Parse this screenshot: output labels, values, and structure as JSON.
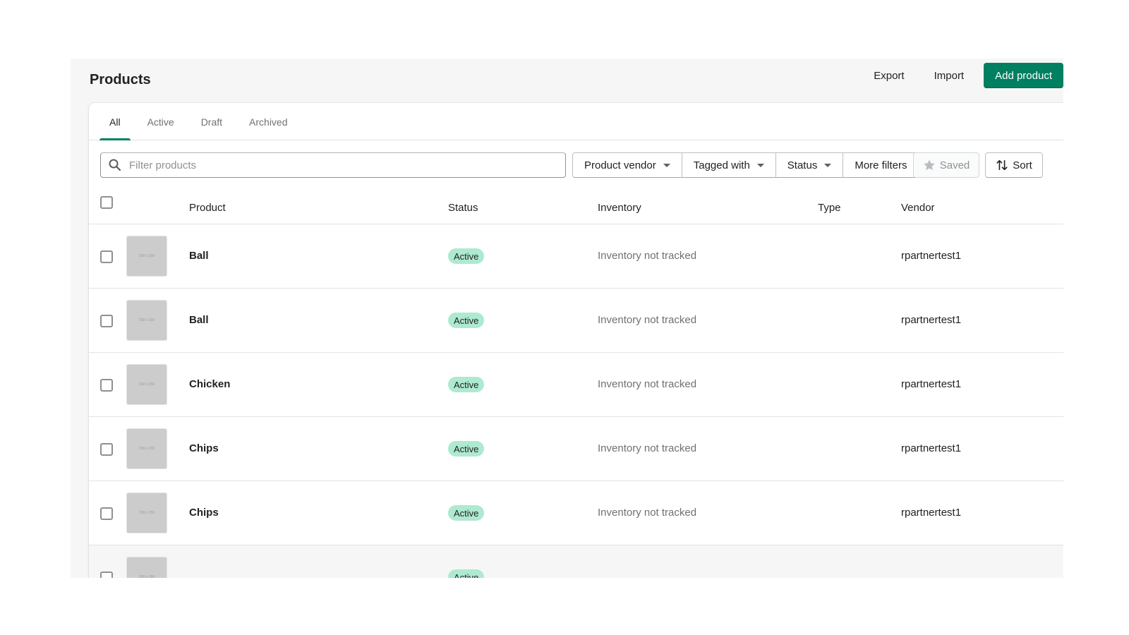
{
  "header": {
    "title": "Products",
    "export_label": "Export",
    "import_label": "Import",
    "add_label": "Add product"
  },
  "tabs": [
    {
      "label": "All",
      "active": true
    },
    {
      "label": "Active"
    },
    {
      "label": "Draft"
    },
    {
      "label": "Archived"
    }
  ],
  "filters": {
    "search_placeholder": "Filter products",
    "vendor_label": "Product vendor",
    "tagged_label": "Tagged with",
    "status_label": "Status",
    "more_label": "More filters",
    "saved_label": "Saved",
    "sort_label": "Sort"
  },
  "table": {
    "columns": {
      "product": "Product",
      "status": "Status",
      "inventory": "Inventory",
      "type": "Type",
      "vendor": "Vendor"
    },
    "thumb_text": "150 x 150",
    "rows": [
      {
        "product": "Ball",
        "status": "Active",
        "inventory": "Inventory not tracked",
        "type": "",
        "vendor": "rpartnertest1"
      },
      {
        "product": "Ball",
        "status": "Active",
        "inventory": "Inventory not tracked",
        "type": "",
        "vendor": "rpartnertest1"
      },
      {
        "product": "Chicken",
        "status": "Active",
        "inventory": "Inventory not tracked",
        "type": "",
        "vendor": "rpartnertest1"
      },
      {
        "product": "Chips",
        "status": "Active",
        "inventory": "Inventory not tracked",
        "type": "",
        "vendor": "rpartnertest1"
      },
      {
        "product": "Chips",
        "status": "Active",
        "inventory": "Inventory not tracked",
        "type": "",
        "vendor": "rpartnertest1"
      },
      {
        "product": "",
        "status": "Active",
        "inventory": "",
        "type": "",
        "vendor": ""
      }
    ]
  },
  "colors": {
    "primary": "#008060",
    "badge_active": "#aee9d1",
    "tab_indicator": "#008060"
  },
  "icons": [
    "search-icon",
    "caret-down-icon",
    "star-icon",
    "sort-arrows-icon"
  ]
}
